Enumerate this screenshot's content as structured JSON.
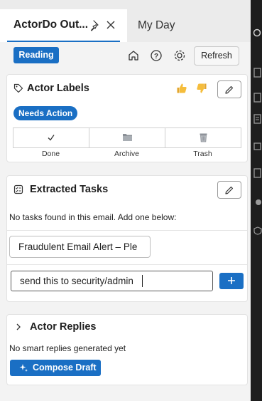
{
  "tabs": [
    {
      "label": "ActorDo Out...",
      "active": true
    },
    {
      "label": "My Day",
      "active": false
    }
  ],
  "toolbar": {
    "mode_badge": "Reading",
    "refresh_label": "Refresh"
  },
  "labels_card": {
    "title": "Actor Labels",
    "status_badge": "Needs Action",
    "actions": [
      {
        "label": "Done",
        "icon": "check-icon"
      },
      {
        "label": "Archive",
        "icon": "folder-icon"
      },
      {
        "label": "Trash",
        "icon": "trash-icon"
      }
    ]
  },
  "tasks_card": {
    "title": "Extracted Tasks",
    "empty_message": "No tasks found in this email. Add one below:",
    "suggestion": "Fraudulent Email Alert – Ple",
    "input_value": "send this to security/admin"
  },
  "replies_card": {
    "title": "Actor Replies",
    "empty_message": "No smart replies generated yet",
    "compose_label": "Compose Draft"
  },
  "colors": {
    "accent": "#1a6fc4",
    "background": "#f3f3f3",
    "sidebar_dark": "#1e1e1e"
  }
}
